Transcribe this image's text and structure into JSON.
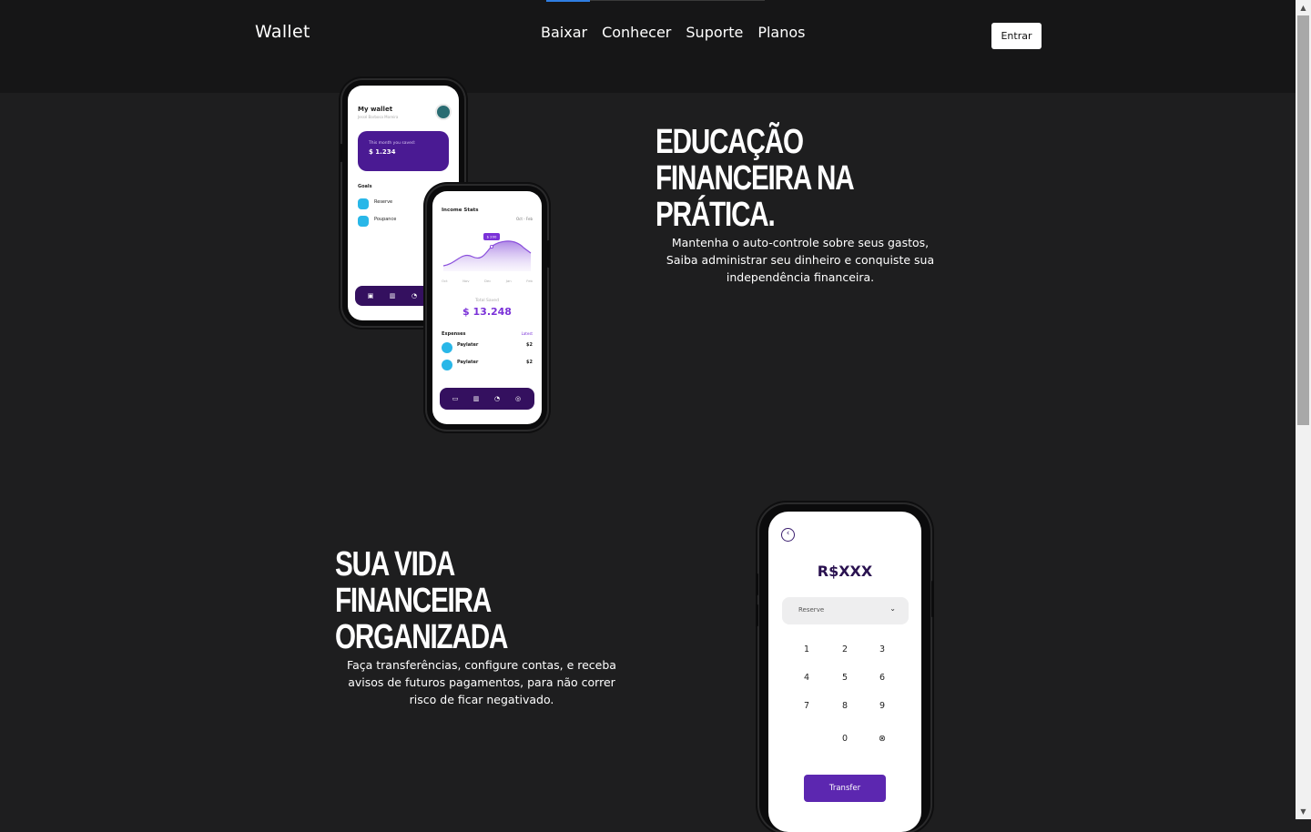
{
  "header": {
    "brand": "Wallet",
    "nav": [
      "Baixar",
      "Conhecer",
      "Suporte",
      "Planos"
    ],
    "login_label": "Entrar"
  },
  "section1": {
    "headline": "Educação financeira na prática.",
    "body": "Mantenha o auto-controle sobre seus gastos, Saiba administrar seu dinheiro e conquiste sua independência financeira."
  },
  "section2": {
    "headline": "Sua vida financeira organizada",
    "body": "Faça transferências, configure contas, e receba avisos de futuros pagamentos, para não correr risco de ficar negativado."
  },
  "phone_wallet": {
    "title": "My wallet",
    "subtitle": "Jessé Barbosa Moreira",
    "card_label": "This month you saved:",
    "card_value": "$ 1.234",
    "goals_title": "Goals",
    "goals": [
      "Reserve",
      "Poupance"
    ]
  },
  "phone_income": {
    "title": "Income Stats",
    "range": "Oct - Feb",
    "tooltip": "$ 200",
    "months": [
      "Oct",
      "Nov",
      "Dec",
      "Jan",
      "Feb"
    ],
    "total_label": "Total Saved",
    "total_value": "$ 13.248",
    "expenses_title": "Expenses",
    "expenses_link": "Latest",
    "expenses": [
      {
        "label": "Paylater",
        "amount": "$2"
      },
      {
        "label": "Paylater",
        "amount": "$2"
      }
    ]
  },
  "phone_transfer": {
    "amount": "R$XXX",
    "select_value": "Reserve",
    "keys": [
      "1",
      "2",
      "3",
      "4",
      "5",
      "6",
      "7",
      "8",
      "9",
      "0"
    ],
    "transfer_label": "Transfer"
  },
  "colors": {
    "background": "#1e1e1f",
    "header": "#161617",
    "accent_purple": "#5c27b0",
    "accent_blue": "#29b7e8"
  }
}
